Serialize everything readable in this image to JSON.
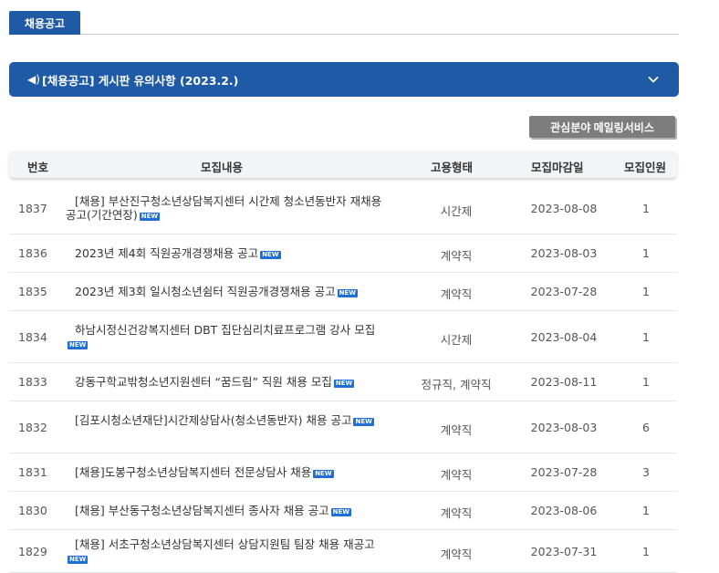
{
  "tab": {
    "label": "채용공고"
  },
  "notice": {
    "icon": "speaker-icon",
    "title": "[채용공고] 게시판 유의사항 (2023.2.)"
  },
  "mailing_button": "관심분야 메일링서비스",
  "table": {
    "headers": {
      "num": "번호",
      "content": "모집내용",
      "type": "고용형태",
      "deadline": "모집마감일",
      "count": "모집인원"
    },
    "new_badge": "NEW",
    "rows": [
      {
        "num": "1837",
        "title": "[채용] 부산진구청소년상담복지센터 시간제 청소년동반자 재채용 공고(기간연장)",
        "type": "시간제",
        "deadline": "2023-08-08",
        "count": "1"
      },
      {
        "num": "1836",
        "title": "2023년 제4회 직원공개경쟁채용 공고",
        "type": "계약직",
        "deadline": "2023-08-03",
        "count": "1"
      },
      {
        "num": "1835",
        "title": "2023년 제3회 일시청소년쉼터 직원공개경쟁채용 공고",
        "type": "계약직",
        "deadline": "2023-07-28",
        "count": "1"
      },
      {
        "num": "1834",
        "title": "하남시정신건강복지센터 DBT 집단심리치료프로그램 강사 모집",
        "type": "시간제",
        "deadline": "2023-08-04",
        "count": "1"
      },
      {
        "num": "1833",
        "title": "강동구학교밖청소년지원센터 “꿈드림” 직원 채용 모집",
        "type": "정규직, 계약직",
        "deadline": "2023-08-11",
        "count": "1"
      },
      {
        "num": "1832",
        "title": "[김포시청소년재단]시간제상담사(청소년동반자) 채용 공고",
        "type": "계약직",
        "deadline": "2023-08-03",
        "count": "6"
      },
      {
        "num": "1831",
        "title": "[채용]도봉구청소년상담복지센터 전문상담사 채용",
        "type": "계약직",
        "deadline": "2023-07-28",
        "count": "3"
      },
      {
        "num": "1830",
        "title": "[채용] 부산동구청소년상담복지센터 종사자 채용 공고",
        "type": "계약직",
        "deadline": "2023-08-06",
        "count": "1"
      },
      {
        "num": "1829",
        "title": "[채용] 서초구청소년상담복지센터 상담지원팀 팀장 채용 재공고",
        "type": "계약직",
        "deadline": "2023-07-31",
        "count": "1"
      }
    ]
  }
}
